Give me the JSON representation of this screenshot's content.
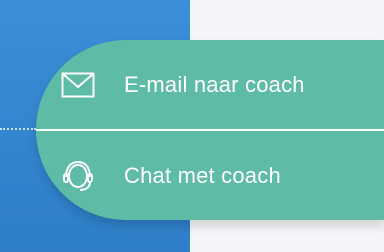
{
  "contact_menu": {
    "email_label": "E-mail naar coach",
    "email_icon": "envelope-icon",
    "chat_label": "Chat met coach",
    "chat_icon": "headset-icon"
  },
  "colors": {
    "menu_background": "#5dbba6",
    "panel_blue": "#2e7ec8",
    "page_background": "#f4f5f8",
    "text": "#ffffff"
  }
}
